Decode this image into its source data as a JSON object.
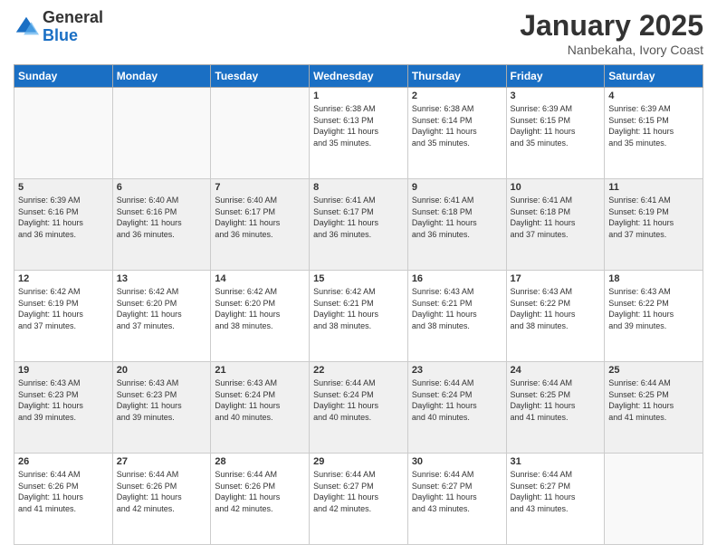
{
  "header": {
    "logo_general": "General",
    "logo_blue": "Blue",
    "month": "January 2025",
    "location": "Nanbekaha, Ivory Coast"
  },
  "days_of_week": [
    "Sunday",
    "Monday",
    "Tuesday",
    "Wednesday",
    "Thursday",
    "Friday",
    "Saturday"
  ],
  "weeks": [
    [
      {
        "day": "",
        "info": ""
      },
      {
        "day": "",
        "info": ""
      },
      {
        "day": "",
        "info": ""
      },
      {
        "day": "1",
        "info": "Sunrise: 6:38 AM\nSunset: 6:13 PM\nDaylight: 11 hours\nand 35 minutes."
      },
      {
        "day": "2",
        "info": "Sunrise: 6:38 AM\nSunset: 6:14 PM\nDaylight: 11 hours\nand 35 minutes."
      },
      {
        "day": "3",
        "info": "Sunrise: 6:39 AM\nSunset: 6:15 PM\nDaylight: 11 hours\nand 35 minutes."
      },
      {
        "day": "4",
        "info": "Sunrise: 6:39 AM\nSunset: 6:15 PM\nDaylight: 11 hours\nand 35 minutes."
      }
    ],
    [
      {
        "day": "5",
        "info": "Sunrise: 6:39 AM\nSunset: 6:16 PM\nDaylight: 11 hours\nand 36 minutes."
      },
      {
        "day": "6",
        "info": "Sunrise: 6:40 AM\nSunset: 6:16 PM\nDaylight: 11 hours\nand 36 minutes."
      },
      {
        "day": "7",
        "info": "Sunrise: 6:40 AM\nSunset: 6:17 PM\nDaylight: 11 hours\nand 36 minutes."
      },
      {
        "day": "8",
        "info": "Sunrise: 6:41 AM\nSunset: 6:17 PM\nDaylight: 11 hours\nand 36 minutes."
      },
      {
        "day": "9",
        "info": "Sunrise: 6:41 AM\nSunset: 6:18 PM\nDaylight: 11 hours\nand 36 minutes."
      },
      {
        "day": "10",
        "info": "Sunrise: 6:41 AM\nSunset: 6:18 PM\nDaylight: 11 hours\nand 37 minutes."
      },
      {
        "day": "11",
        "info": "Sunrise: 6:41 AM\nSunset: 6:19 PM\nDaylight: 11 hours\nand 37 minutes."
      }
    ],
    [
      {
        "day": "12",
        "info": "Sunrise: 6:42 AM\nSunset: 6:19 PM\nDaylight: 11 hours\nand 37 minutes."
      },
      {
        "day": "13",
        "info": "Sunrise: 6:42 AM\nSunset: 6:20 PM\nDaylight: 11 hours\nand 37 minutes."
      },
      {
        "day": "14",
        "info": "Sunrise: 6:42 AM\nSunset: 6:20 PM\nDaylight: 11 hours\nand 38 minutes."
      },
      {
        "day": "15",
        "info": "Sunrise: 6:42 AM\nSunset: 6:21 PM\nDaylight: 11 hours\nand 38 minutes."
      },
      {
        "day": "16",
        "info": "Sunrise: 6:43 AM\nSunset: 6:21 PM\nDaylight: 11 hours\nand 38 minutes."
      },
      {
        "day": "17",
        "info": "Sunrise: 6:43 AM\nSunset: 6:22 PM\nDaylight: 11 hours\nand 38 minutes."
      },
      {
        "day": "18",
        "info": "Sunrise: 6:43 AM\nSunset: 6:22 PM\nDaylight: 11 hours\nand 39 minutes."
      }
    ],
    [
      {
        "day": "19",
        "info": "Sunrise: 6:43 AM\nSunset: 6:23 PM\nDaylight: 11 hours\nand 39 minutes."
      },
      {
        "day": "20",
        "info": "Sunrise: 6:43 AM\nSunset: 6:23 PM\nDaylight: 11 hours\nand 39 minutes."
      },
      {
        "day": "21",
        "info": "Sunrise: 6:43 AM\nSunset: 6:24 PM\nDaylight: 11 hours\nand 40 minutes."
      },
      {
        "day": "22",
        "info": "Sunrise: 6:44 AM\nSunset: 6:24 PM\nDaylight: 11 hours\nand 40 minutes."
      },
      {
        "day": "23",
        "info": "Sunrise: 6:44 AM\nSunset: 6:24 PM\nDaylight: 11 hours\nand 40 minutes."
      },
      {
        "day": "24",
        "info": "Sunrise: 6:44 AM\nSunset: 6:25 PM\nDaylight: 11 hours\nand 41 minutes."
      },
      {
        "day": "25",
        "info": "Sunrise: 6:44 AM\nSunset: 6:25 PM\nDaylight: 11 hours\nand 41 minutes."
      }
    ],
    [
      {
        "day": "26",
        "info": "Sunrise: 6:44 AM\nSunset: 6:26 PM\nDaylight: 11 hours\nand 41 minutes."
      },
      {
        "day": "27",
        "info": "Sunrise: 6:44 AM\nSunset: 6:26 PM\nDaylight: 11 hours\nand 42 minutes."
      },
      {
        "day": "28",
        "info": "Sunrise: 6:44 AM\nSunset: 6:26 PM\nDaylight: 11 hours\nand 42 minutes."
      },
      {
        "day": "29",
        "info": "Sunrise: 6:44 AM\nSunset: 6:27 PM\nDaylight: 11 hours\nand 42 minutes."
      },
      {
        "day": "30",
        "info": "Sunrise: 6:44 AM\nSunset: 6:27 PM\nDaylight: 11 hours\nand 43 minutes."
      },
      {
        "day": "31",
        "info": "Sunrise: 6:44 AM\nSunset: 6:27 PM\nDaylight: 11 hours\nand 43 minutes."
      },
      {
        "day": "",
        "info": ""
      }
    ]
  ]
}
